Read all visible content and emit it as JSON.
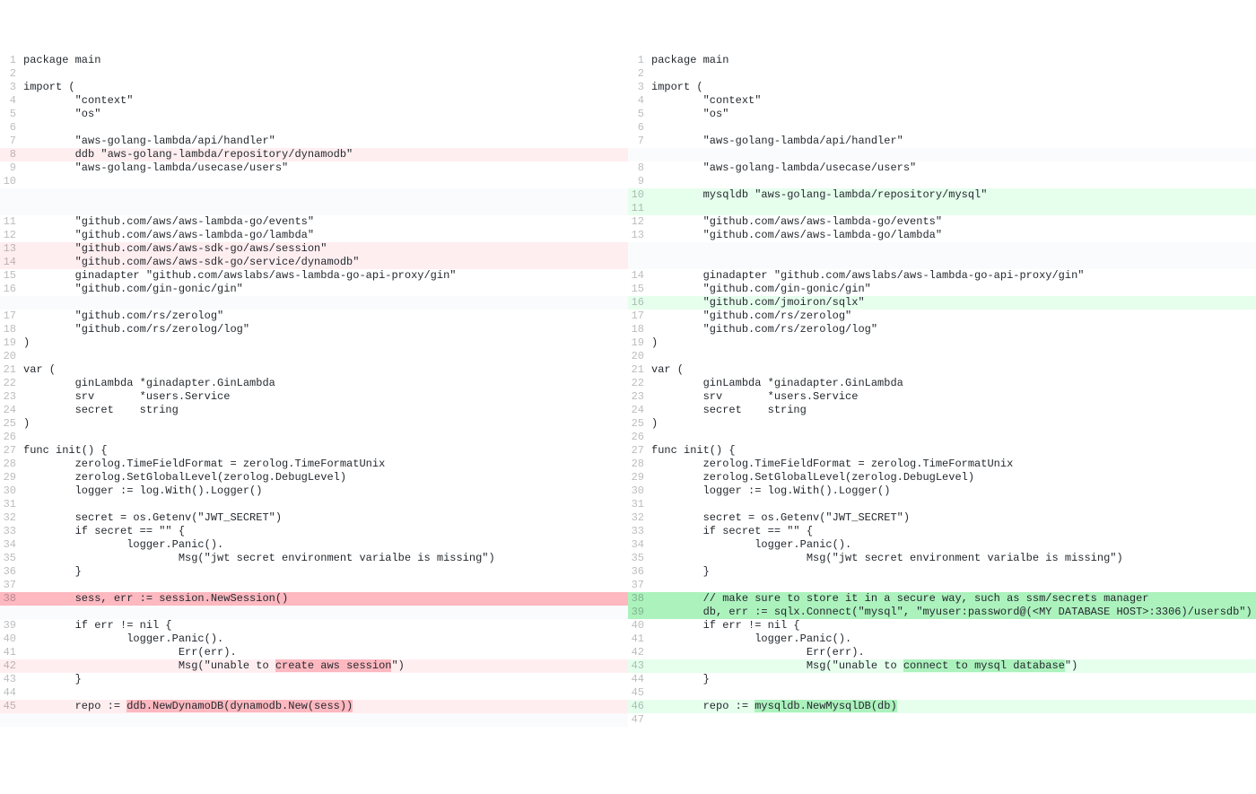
{
  "left": [
    {
      "n": 1,
      "t": "package main",
      "cls": ""
    },
    {
      "n": 2,
      "t": "",
      "cls": ""
    },
    {
      "n": 3,
      "t": "import (",
      "cls": ""
    },
    {
      "n": 4,
      "t": "        \"context\"",
      "cls": ""
    },
    {
      "n": 5,
      "t": "        \"os\"",
      "cls": ""
    },
    {
      "n": 6,
      "t": "",
      "cls": ""
    },
    {
      "n": 7,
      "t": "        \"aws-golang-lambda/api/handler\"",
      "cls": ""
    },
    {
      "n": 8,
      "t": "        ddb \"aws-golang-lambda/repository/dynamodb\"",
      "cls": "del"
    },
    {
      "n": 9,
      "t": "        \"aws-golang-lambda/usecase/users\"",
      "cls": ""
    },
    {
      "n": 10,
      "t": "",
      "cls": ""
    },
    {
      "n": null,
      "t": "",
      "cls": "empty"
    },
    {
      "n": null,
      "t": "",
      "cls": "empty"
    },
    {
      "n": 11,
      "t": "        \"github.com/aws/aws-lambda-go/events\"",
      "cls": ""
    },
    {
      "n": 12,
      "t": "        \"github.com/aws/aws-lambda-go/lambda\"",
      "cls": ""
    },
    {
      "n": 13,
      "t": "        \"github.com/aws/aws-sdk-go/aws/session\"",
      "cls": "del"
    },
    {
      "n": 14,
      "t": "        \"github.com/aws/aws-sdk-go/service/dynamodb\"",
      "cls": "del"
    },
    {
      "n": 15,
      "t": "        ginadapter \"github.com/awslabs/aws-lambda-go-api-proxy/gin\"",
      "cls": ""
    },
    {
      "n": 16,
      "t": "        \"github.com/gin-gonic/gin\"",
      "cls": ""
    },
    {
      "n": null,
      "t": "",
      "cls": "empty"
    },
    {
      "n": 17,
      "t": "        \"github.com/rs/zerolog\"",
      "cls": ""
    },
    {
      "n": 18,
      "t": "        \"github.com/rs/zerolog/log\"",
      "cls": ""
    },
    {
      "n": 19,
      "t": ")",
      "cls": ""
    },
    {
      "n": 20,
      "t": "",
      "cls": ""
    },
    {
      "n": 21,
      "t": "var (",
      "cls": ""
    },
    {
      "n": 22,
      "t": "        ginLambda *ginadapter.GinLambda",
      "cls": ""
    },
    {
      "n": 23,
      "t": "        srv       *users.Service",
      "cls": ""
    },
    {
      "n": 24,
      "t": "        secret    string",
      "cls": ""
    },
    {
      "n": 25,
      "t": ")",
      "cls": ""
    },
    {
      "n": 26,
      "t": "",
      "cls": ""
    },
    {
      "n": 27,
      "t": "func init() {",
      "cls": ""
    },
    {
      "n": 28,
      "t": "        zerolog.TimeFieldFormat = zerolog.TimeFormatUnix",
      "cls": ""
    },
    {
      "n": 29,
      "t": "        zerolog.SetGlobalLevel(zerolog.DebugLevel)",
      "cls": ""
    },
    {
      "n": 30,
      "t": "        logger := log.With().Logger()",
      "cls": ""
    },
    {
      "n": 31,
      "t": "",
      "cls": ""
    },
    {
      "n": 32,
      "t": "        secret = os.Getenv(\"JWT_SECRET\")",
      "cls": ""
    },
    {
      "n": 33,
      "t": "        if secret == \"\" {",
      "cls": ""
    },
    {
      "n": 34,
      "t": "                logger.Panic().",
      "cls": ""
    },
    {
      "n": 35,
      "t": "                        Msg(\"jwt secret environment varialbe is missing\")",
      "cls": ""
    },
    {
      "n": 36,
      "t": "        }",
      "cls": ""
    },
    {
      "n": 37,
      "t": "",
      "cls": ""
    },
    {
      "n": 38,
      "t": "",
      "cls": "del-strong",
      "segments": [
        {
          "t": "        ",
          "h": false
        },
        {
          "t": "sess, err := session.NewSession()",
          "h": true
        }
      ]
    },
    {
      "n": null,
      "t": "",
      "cls": "empty"
    },
    {
      "n": 39,
      "t": "        if err != nil {",
      "cls": ""
    },
    {
      "n": 40,
      "t": "                logger.Panic().",
      "cls": ""
    },
    {
      "n": 41,
      "t": "                        Err(err).",
      "cls": ""
    },
    {
      "n": 42,
      "t": "",
      "cls": "del",
      "segments": [
        {
          "t": "                        Msg(\"unable to ",
          "h": false
        },
        {
          "t": "create aws session",
          "h": true
        },
        {
          "t": "\")",
          "h": false
        }
      ]
    },
    {
      "n": 43,
      "t": "        }",
      "cls": ""
    },
    {
      "n": 44,
      "t": "",
      "cls": ""
    },
    {
      "n": 45,
      "t": "",
      "cls": "del",
      "segments": [
        {
          "t": "        repo := ",
          "h": false
        },
        {
          "t": "ddb.NewDynamoDB(dynamodb.New(sess))",
          "h": true
        }
      ]
    },
    {
      "n": null,
      "t": "",
      "cls": "empty"
    }
  ],
  "right": [
    {
      "n": 1,
      "t": "package main",
      "cls": ""
    },
    {
      "n": 2,
      "t": "",
      "cls": ""
    },
    {
      "n": 3,
      "t": "import (",
      "cls": ""
    },
    {
      "n": 4,
      "t": "        \"context\"",
      "cls": ""
    },
    {
      "n": 5,
      "t": "        \"os\"",
      "cls": ""
    },
    {
      "n": 6,
      "t": "",
      "cls": ""
    },
    {
      "n": 7,
      "t": "        \"aws-golang-lambda/api/handler\"",
      "cls": ""
    },
    {
      "n": null,
      "t": "",
      "cls": "empty"
    },
    {
      "n": 8,
      "t": "        \"aws-golang-lambda/usecase/users\"",
      "cls": ""
    },
    {
      "n": 9,
      "t": "",
      "cls": ""
    },
    {
      "n": 10,
      "t": "        mysqldb \"aws-golang-lambda/repository/mysql\"",
      "cls": "add"
    },
    {
      "n": 11,
      "t": "",
      "cls": "add"
    },
    {
      "n": 12,
      "t": "        \"github.com/aws/aws-lambda-go/events\"",
      "cls": ""
    },
    {
      "n": 13,
      "t": "        \"github.com/aws/aws-lambda-go/lambda\"",
      "cls": ""
    },
    {
      "n": null,
      "t": "",
      "cls": "empty"
    },
    {
      "n": null,
      "t": "",
      "cls": "empty"
    },
    {
      "n": 14,
      "t": "        ginadapter \"github.com/awslabs/aws-lambda-go-api-proxy/gin\"",
      "cls": ""
    },
    {
      "n": 15,
      "t": "        \"github.com/gin-gonic/gin\"",
      "cls": ""
    },
    {
      "n": 16,
      "t": "        \"github.com/jmoiron/sqlx\"",
      "cls": "add"
    },
    {
      "n": 17,
      "t": "        \"github.com/rs/zerolog\"",
      "cls": ""
    },
    {
      "n": 18,
      "t": "        \"github.com/rs/zerolog/log\"",
      "cls": ""
    },
    {
      "n": 19,
      "t": ")",
      "cls": ""
    },
    {
      "n": 20,
      "t": "",
      "cls": ""
    },
    {
      "n": 21,
      "t": "var (",
      "cls": ""
    },
    {
      "n": 22,
      "t": "        ginLambda *ginadapter.GinLambda",
      "cls": ""
    },
    {
      "n": 23,
      "t": "        srv       *users.Service",
      "cls": ""
    },
    {
      "n": 24,
      "t": "        secret    string",
      "cls": ""
    },
    {
      "n": 25,
      "t": ")",
      "cls": ""
    },
    {
      "n": 26,
      "t": "",
      "cls": ""
    },
    {
      "n": 27,
      "t": "func init() {",
      "cls": ""
    },
    {
      "n": 28,
      "t": "        zerolog.TimeFieldFormat = zerolog.TimeFormatUnix",
      "cls": ""
    },
    {
      "n": 29,
      "t": "        zerolog.SetGlobalLevel(zerolog.DebugLevel)",
      "cls": ""
    },
    {
      "n": 30,
      "t": "        logger := log.With().Logger()",
      "cls": ""
    },
    {
      "n": 31,
      "t": "",
      "cls": ""
    },
    {
      "n": 32,
      "t": "        secret = os.Getenv(\"JWT_SECRET\")",
      "cls": ""
    },
    {
      "n": 33,
      "t": "        if secret == \"\" {",
      "cls": ""
    },
    {
      "n": 34,
      "t": "                logger.Panic().",
      "cls": ""
    },
    {
      "n": 35,
      "t": "                        Msg(\"jwt secret environment varialbe is missing\")",
      "cls": ""
    },
    {
      "n": 36,
      "t": "        }",
      "cls": ""
    },
    {
      "n": 37,
      "t": "",
      "cls": ""
    },
    {
      "n": 38,
      "t": "",
      "cls": "add-strong",
      "segments": [
        {
          "t": "        ",
          "h": false
        },
        {
          "t": "// make sure to store it in a secure way, such as ssm/secrets manager",
          "h": true
        }
      ]
    },
    {
      "n": 39,
      "t": "",
      "cls": "add-strong",
      "segments": [
        {
          "t": "        ",
          "h": false
        },
        {
          "t": "db, err := sqlx.Connect(\"mysql\", \"myuser:password@(<MY DATABASE HOST>:3306)/usersdb\")",
          "h": true
        }
      ]
    },
    {
      "n": 40,
      "t": "        if err != nil {",
      "cls": ""
    },
    {
      "n": 41,
      "t": "                logger.Panic().",
      "cls": ""
    },
    {
      "n": 42,
      "t": "                        Err(err).",
      "cls": ""
    },
    {
      "n": 43,
      "t": "",
      "cls": "add",
      "segments": [
        {
          "t": "                        Msg(\"unable to ",
          "h": false
        },
        {
          "t": "connect to mysql database",
          "h": true
        },
        {
          "t": "\")",
          "h": false
        }
      ]
    },
    {
      "n": 44,
      "t": "        }",
      "cls": ""
    },
    {
      "n": 45,
      "t": "",
      "cls": ""
    },
    {
      "n": 46,
      "t": "",
      "cls": "add",
      "segments": [
        {
          "t": "        repo := ",
          "h": false
        },
        {
          "t": "mysqldb.NewMysqlDB(db)",
          "h": true
        }
      ]
    },
    {
      "n": 47,
      "t": "",
      "cls": ""
    }
  ]
}
